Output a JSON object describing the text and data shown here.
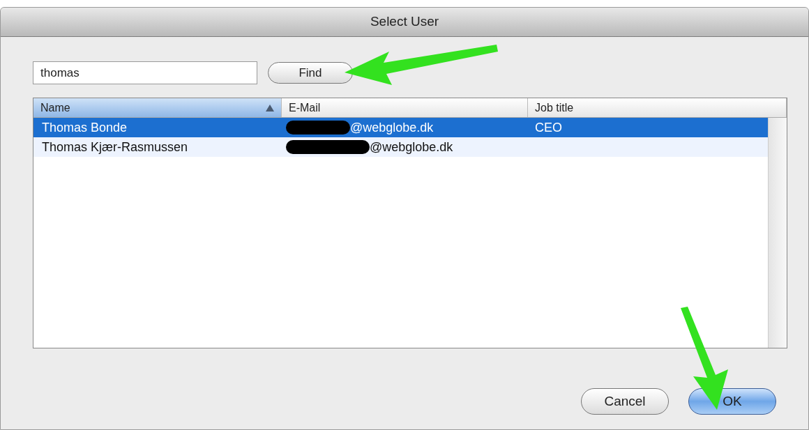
{
  "window": {
    "title": "Select User"
  },
  "search": {
    "value": "thomas"
  },
  "find_button": "Find",
  "table": {
    "columns": [
      {
        "label": "Name",
        "sorted": true
      },
      {
        "label": "E-Mail",
        "sorted": false
      },
      {
        "label": "Job title",
        "sorted": false
      }
    ],
    "rows": [
      {
        "selected": true,
        "name": "Thomas Bonde",
        "email": "@webglobe.dk",
        "job_title": "CEO"
      },
      {
        "selected": false,
        "name": "Thomas Kjær-Rasmussen",
        "email": "@webglobe.dk"
      }
    ]
  },
  "buttons": [
    {
      "label": "Cancel",
      "kind": "default"
    },
    {
      "label": "OK",
      "kind": "primary"
    }
  ]
}
